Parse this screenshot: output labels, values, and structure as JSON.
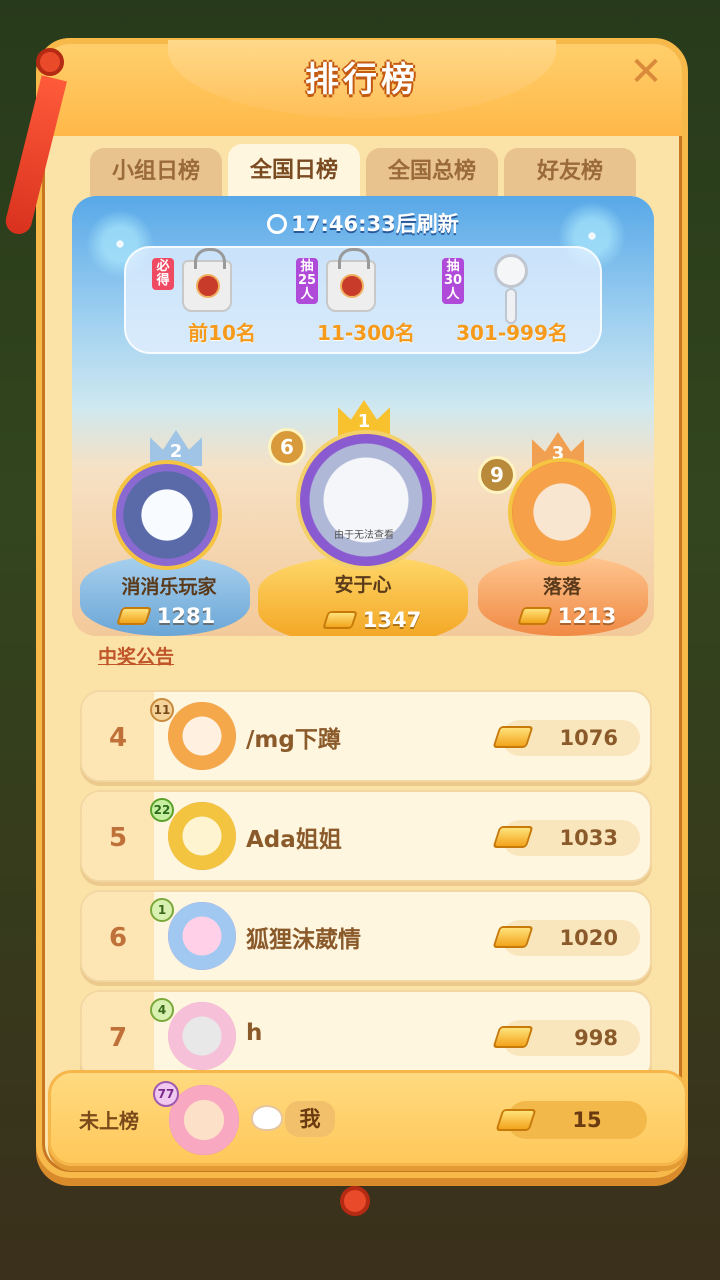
{
  "header": {
    "title": "排行榜"
  },
  "tabs": [
    {
      "label": "小组日榜",
      "active": false
    },
    {
      "label": "全国日榜",
      "active": true
    },
    {
      "label": "全国总榜",
      "active": false
    },
    {
      "label": "好友榜",
      "active": false
    }
  ],
  "refresh": {
    "text": "17:46:33后刷新"
  },
  "prizes": [
    {
      "tag": "必得",
      "range": "前10名",
      "item": "bag"
    },
    {
      "tag": "抽25人",
      "range": "11-300名",
      "item": "bag"
    },
    {
      "tag": "抽30人",
      "range": "301-999名",
      "item": "fan"
    }
  ],
  "podium": {
    "first": {
      "rank": "1",
      "level": "6",
      "name": "安于心",
      "score": "1347",
      "overlay": "由于无法查看"
    },
    "second": {
      "rank": "2",
      "level": "",
      "name": "消消乐玩家",
      "score": "1281"
    },
    "third": {
      "rank": "3",
      "level": "9",
      "name": "落落",
      "score": "1213"
    }
  },
  "announcement": "中奖公告",
  "list": [
    {
      "rank": "4",
      "level": "11",
      "name": "/mg下蹲",
      "score": "1076"
    },
    {
      "rank": "5",
      "level": "22",
      "name": "Ada姐姐",
      "score": "1033"
    },
    {
      "rank": "6",
      "level": "1",
      "name": "狐狸沫葳情",
      "score": "1020"
    },
    {
      "rank": "7",
      "level": "4",
      "name": "h",
      "score": "998"
    }
  ],
  "me": {
    "rank_label": "未上榜",
    "level": "77",
    "name": "我",
    "score": "15"
  },
  "colors": {
    "accent": "#f6b94a",
    "frame_bg": "#fbe3a8",
    "gold": "#f2a41c"
  }
}
